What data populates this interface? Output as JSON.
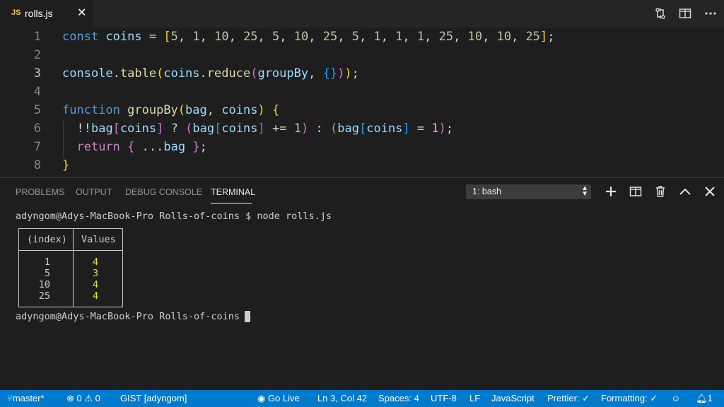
{
  "tab": {
    "icon_text": "JS",
    "filename": "rolls.js",
    "close_glyph": "✕"
  },
  "toolbar_icons": [
    "git-compare-icon",
    "split-editor-icon",
    "more-actions-icon"
  ],
  "editor": {
    "lines": [
      {
        "num": "1"
      },
      {
        "num": "2"
      },
      {
        "num": "3"
      },
      {
        "num": "4"
      },
      {
        "num": "5"
      },
      {
        "num": "6"
      },
      {
        "num": "7"
      },
      {
        "num": "8"
      }
    ],
    "code": {
      "l1": [
        "const",
        "coins",
        "=",
        "[",
        "5",
        "1",
        "10",
        "25",
        "5",
        "10",
        "25",
        "5",
        "1",
        "1",
        "1",
        "25",
        "10",
        "10",
        "25",
        "]",
        ";"
      ],
      "l3": [
        "console",
        ".",
        "table",
        "(",
        "coins",
        ".",
        "reduce",
        "(",
        "groupBy",
        ", ",
        "{}",
        ")",
        ")",
        ";"
      ],
      "l5": [
        "function",
        "groupBy",
        "(",
        "bag",
        ", ",
        "coins",
        ")",
        "{"
      ],
      "l6": [
        "!!",
        "bag",
        "[",
        "coins",
        "]",
        "?",
        "(",
        "bag",
        "[",
        "coins",
        "]",
        "+=",
        "1",
        ")",
        ":",
        "(",
        "bag",
        "[",
        "coins",
        "]",
        "=",
        "1",
        ")",
        ";"
      ],
      "l7": [
        "return",
        "{",
        "...",
        "bag",
        "}",
        ";"
      ],
      "l8": [
        "}"
      ]
    }
  },
  "panel": {
    "tabs": [
      "PROBLEMS",
      "OUTPUT",
      "DEBUG CONSOLE",
      "TERMINAL"
    ],
    "active_tab": "TERMINAL",
    "terminal_select": "1: bash",
    "icons": [
      "add-terminal-icon",
      "split-terminal-icon",
      "kill-terminal-icon",
      "maximize-panel-icon",
      "close-panel-icon"
    ]
  },
  "terminal": {
    "prompt1": "adyngom@Adys-MacBook-Pro Rolls-of-coins $ node rolls.js",
    "table": {
      "headers": [
        "(index)",
        "Values"
      ],
      "rows": [
        {
          "index": "1",
          "value": "4"
        },
        {
          "index": "5",
          "value": "3"
        },
        {
          "index": "10",
          "value": "4"
        },
        {
          "index": "25",
          "value": "4"
        }
      ]
    },
    "prompt2": "adyngom@Adys-MacBook-Pro Rolls-of-coins $"
  },
  "status": {
    "branch": "master*",
    "errors": "0",
    "warnings": "0",
    "gist": "GIST [adyngom]",
    "golive": "Go Live",
    "position": "Ln 3, Col 42",
    "spaces": "Spaces: 4",
    "encoding": "UTF-8",
    "eol": "LF",
    "language": "JavaScript",
    "prettier": "Prettier:",
    "formatting": "Formatting:",
    "notifications": "1"
  },
  "colors": {
    "status_bar": "#007acc",
    "editor_bg": "#1e1e1e",
    "keyword": "#569cd6",
    "variable": "#9cdcfe",
    "function": "#dcdcaa",
    "number": "#b5cea8",
    "bracket_level1": "#ffd700",
    "bracket_level2": "#da70d6",
    "terminal_value": "#e5e510"
  }
}
